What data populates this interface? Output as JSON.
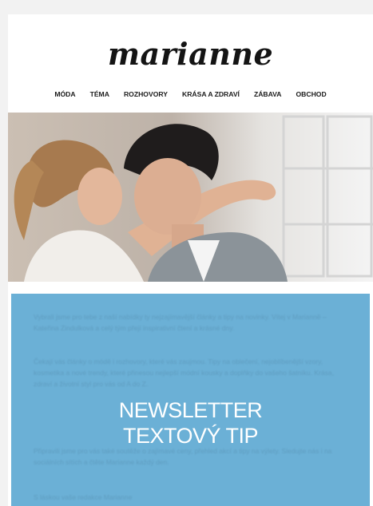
{
  "brand": {
    "logo_text": "marianne"
  },
  "nav": {
    "items": [
      {
        "label": "MÓDA"
      },
      {
        "label": "TÉMA"
      },
      {
        "label": "ROZHOVORY"
      },
      {
        "label": "KRÁSA A ZDRAVÍ"
      },
      {
        "label": "ZÁBAVA"
      },
      {
        "label": "OBCHOD"
      }
    ]
  },
  "hero": {
    "image_icon": "couple-photo"
  },
  "newsletter": {
    "title_line1": "NEWSLETTER",
    "title_line2": "TEXTOVÝ TIP",
    "background_color": "#6bb0d6",
    "paragraphs": [
      {
        "text": "Vybrali jsme pro tebe z naší nabídky ty nejzajímavější články a tipy na novinky. Vítej v Marianně – Kateřina Zindulková a celý tým přejí inspirativní čtení a krásné dny."
      },
      {
        "text": "Čekají vás články o módě i rozhovory, které vás zaujmou. Tipy na oblečení, nejoblíbenější vzory, kosmetika a nové trendy, které přinesou nejlepší módní kousky a doplňky do vašeho šatníku. Krása, zdraví a životní styl pro vás od A do Z."
      },
      {
        "text": "Připravili jsme pro vás také soutěže o zajímavé ceny, přehled akcí a tipy na výlety. Sledujte nás i na sociálních sítích a čtěte Marianne každý den."
      }
    ],
    "footer_text": "S láskou vaše redakce Marianne"
  }
}
